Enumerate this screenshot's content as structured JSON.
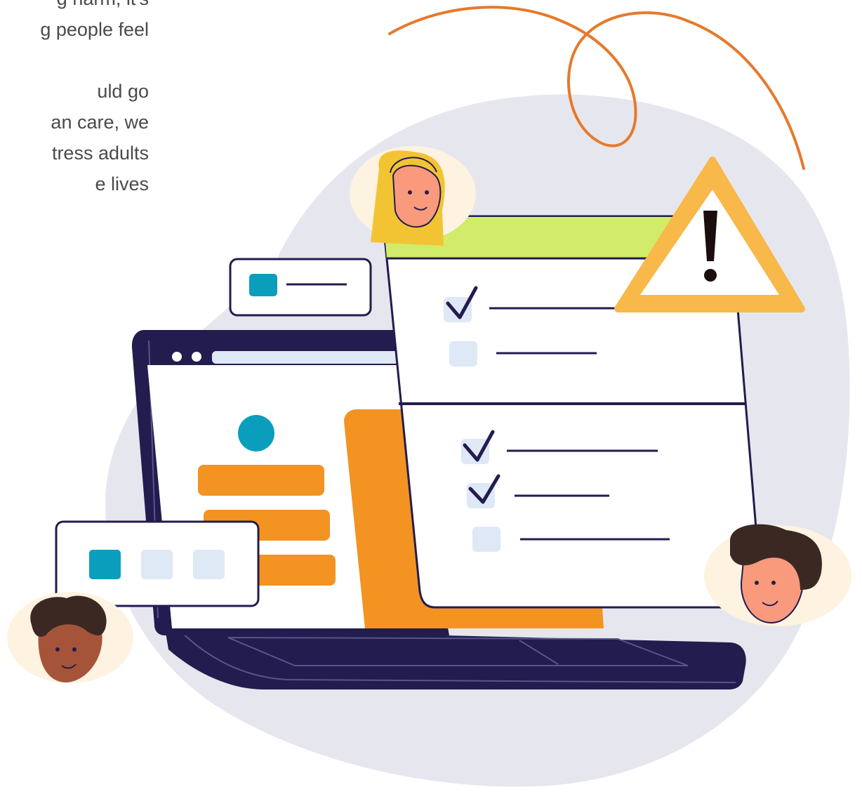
{
  "text": {
    "lines": [
      "g harm, it's",
      "g people feel",
      "",
      "uld go",
      "an care, we",
      "tress adults",
      "e lives"
    ]
  },
  "colors": {
    "background_blob": "#e6e7ee",
    "navy": "#221c4f",
    "orange": "#f39322",
    "teal": "#0a9ebc",
    "light_blue": "#dfe8f5",
    "lime": "#d1ec6a",
    "warning_yellow": "#f9b84a",
    "scribble": "#e57a2c",
    "skin_light": "#f99a7c",
    "skin_dark": "#a5543a",
    "hair_dark": "#3b2823",
    "hair_blonde": "#f2c433",
    "halo": "#fdf3e0"
  },
  "icons": [
    "checkmark-icon",
    "warning-icon",
    "exclamation-icon"
  ]
}
